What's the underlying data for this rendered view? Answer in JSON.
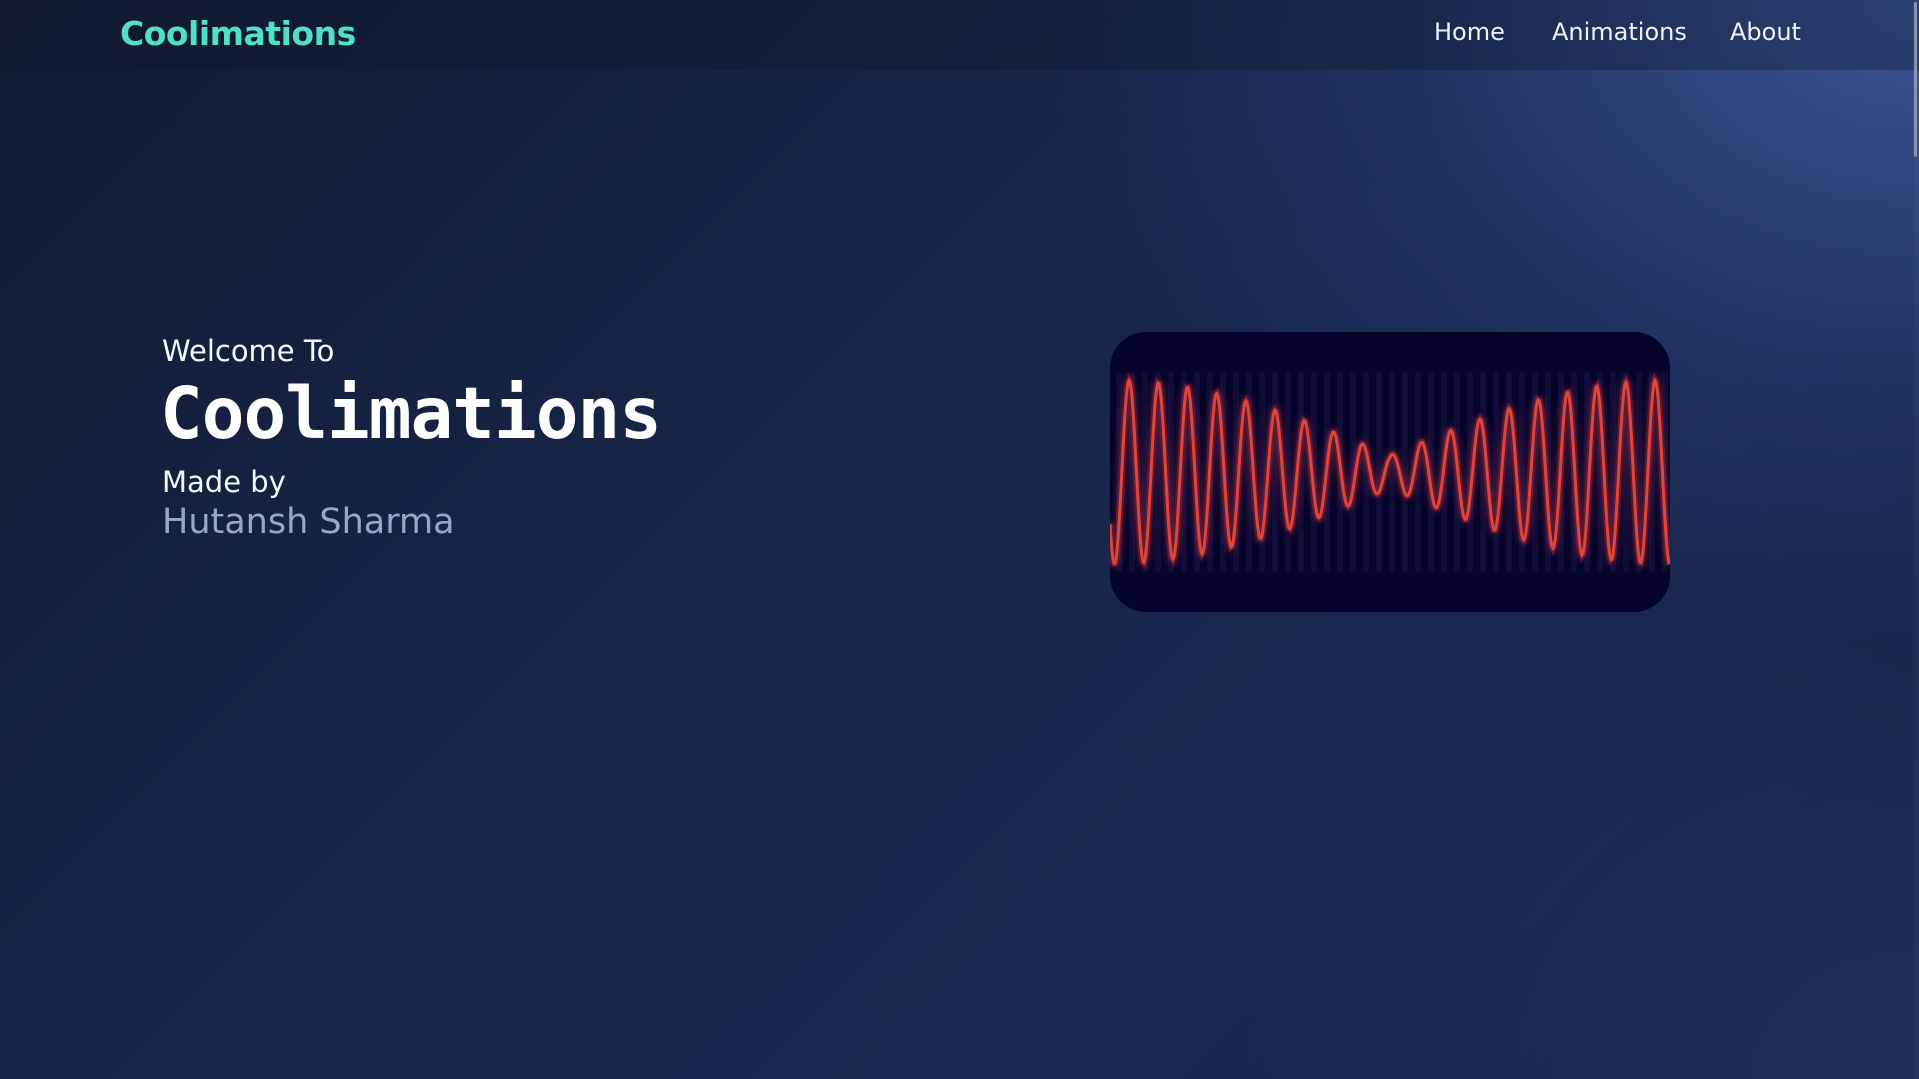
{
  "header": {
    "brand": "Coolimations",
    "nav": [
      "Home",
      "Animations",
      "About"
    ]
  },
  "hero": {
    "welcome": "Welcome To",
    "title": "Coolimations",
    "made_by": "Made by",
    "author": "Hutansh Sharma"
  },
  "colors": {
    "brand": "#4fe0c5",
    "wave": "#e0453c",
    "panel": "#04042a"
  }
}
